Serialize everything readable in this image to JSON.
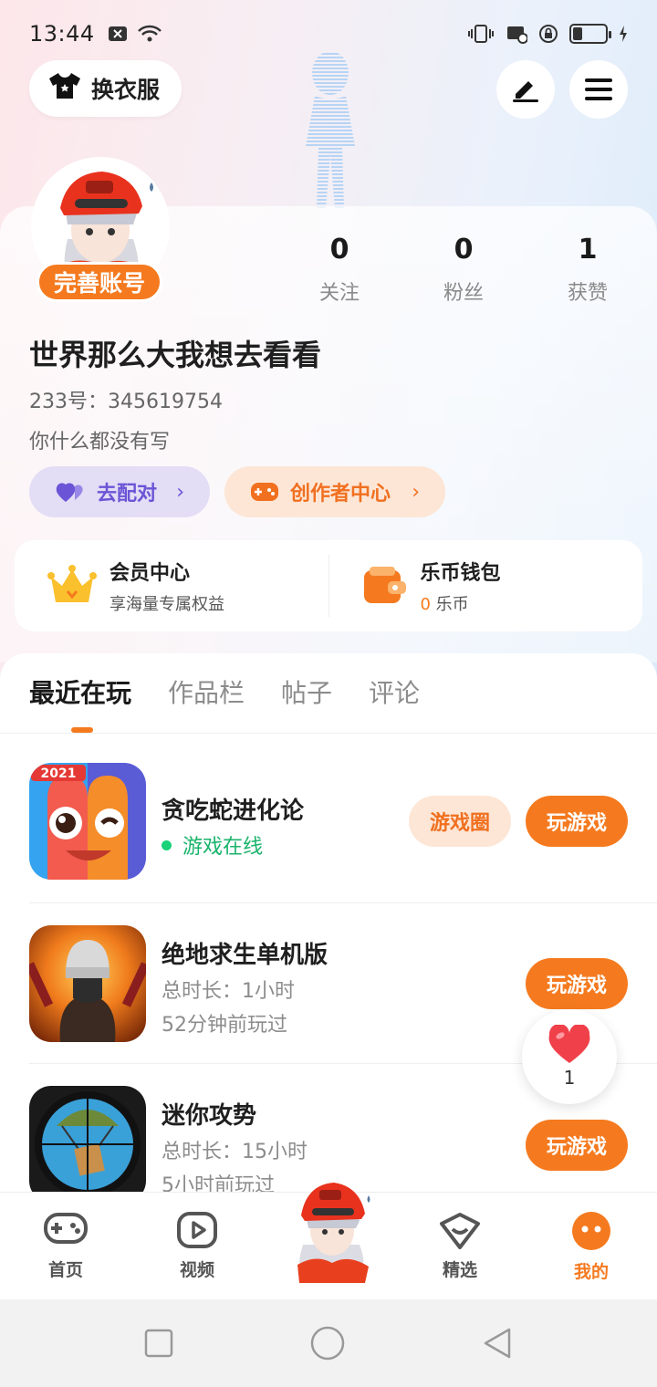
{
  "status_bar": {
    "time": "13:44"
  },
  "header": {
    "outfit_label": "换衣服"
  },
  "profile": {
    "complete_badge": "完善账号",
    "stats": [
      {
        "value": "0",
        "label": "关注"
      },
      {
        "value": "0",
        "label": "粉丝"
      },
      {
        "value": "1",
        "label": "获赞"
      }
    ],
    "username": "世界那么大我想去看看",
    "uid": "233号：345619754",
    "bio": "你什么都没有写",
    "match_label": "去配对",
    "creator_label": "创作者中心"
  },
  "wallet": {
    "vip_title": "会员中心",
    "vip_sub": "享海量专属权益",
    "coin_title": "乐币钱包",
    "coin_amount": "0",
    "coin_unit": " 乐币"
  },
  "tabs": [
    "最近在玩",
    "作品栏",
    "帖子",
    "评论"
  ],
  "games": [
    {
      "name": "贪吃蛇进化论",
      "status": "游戏在线",
      "circle_label": "游戏圈",
      "play_label": "玩游戏",
      "icon": "snake-game-icon",
      "badge": "2021"
    },
    {
      "name": "绝地求生单机版",
      "duration": "总时长：1小时",
      "last_played": "52分钟前玩过",
      "play_label": "玩游戏",
      "icon": "pubg-game-icon"
    },
    {
      "name": "迷你攻势",
      "duration": "总时长：15小时",
      "last_played": "5小时前玩过",
      "play_label": "玩游戏",
      "icon": "mini-strike-game-icon"
    }
  ],
  "like_float": {
    "count": "1"
  },
  "bottom_nav": [
    {
      "label": "首页",
      "icon": "gamepad-icon"
    },
    {
      "label": "视频",
      "icon": "video-play-icon"
    },
    {
      "label": "精选",
      "icon": "heart-box-icon"
    },
    {
      "label": "我的",
      "icon": "face-icon"
    }
  ],
  "colors": {
    "accent": "#f57a1f",
    "online": "#19b46b",
    "match": "#6b55d6"
  }
}
